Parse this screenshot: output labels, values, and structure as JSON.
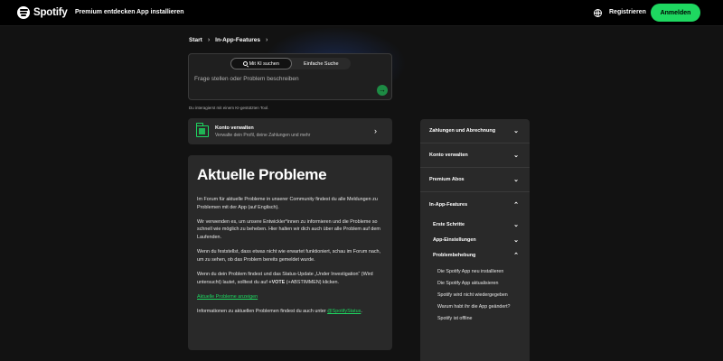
{
  "nav": {
    "logo_text": "Spotify",
    "links": [
      "Premium entdecken",
      "App installieren"
    ],
    "signup": "Registrieren",
    "login": "Anmelden"
  },
  "breadcrumb": [
    "Start",
    "In-App-Features"
  ],
  "search": {
    "tab_ai": "Mit KI suchen",
    "tab_simple": "Einfache Suche",
    "placeholder": "Frage stellen oder Problem beschreiben",
    "send_icon": "arrow-right",
    "ai_note": "Du interagierst mit einem KI-gestützten Tool."
  },
  "account_card": {
    "title": "Konto verwalten",
    "subtitle": "Verwalte dein Profil, deine Zahlungen und mehr"
  },
  "article": {
    "title": "Aktuelle Probleme",
    "p1": "Im Forum für aktuelle Probleme in unserer Community findest du alle Meldungen zu Problemen mit der App (auf Englisch).",
    "p2": "Wir verwenden es, um unsere Entwickler*innen zu informieren und die Probleme so schnell wie möglich zu beheben. Hier halten wir dich auch über alle Problem auf dem Laufenden.",
    "p3": "Wenn du feststellst, dass etwas nicht wie erwartet funktioniert, schau im Forum nach, um zu sehen, ob das Problem bereits gemeldet wurde.",
    "p4_a": "Wenn du dein Problem findest und das Status-Update „Under Investigation“ (Wird untersucht) lautet, solltest du auf ",
    "p4_b": "+VOTE",
    "p4_c": " (+ABSTIMMEN) klicken.",
    "link": "Aktuelle Probleme anzeigen",
    "p5_a": "Informationen zu aktuellen Problemen findest du auch unter ",
    "p5_link": "@SpotifyStatus",
    "p5_b": "."
  },
  "sidebar": {
    "items": [
      "Zahlungen und Abrechnung",
      "Konto verwalten",
      "Premium Abos",
      "In-App-Features"
    ],
    "sub": [
      "Erste Schritte",
      "App-Einstellungen",
      "Problembehebung"
    ],
    "leaves": [
      "Die Spotify App neu installieren",
      "Die Spotify App aktualisieren",
      "Spotify wird nicht wiedergegeben",
      "Warum habt ihr die App geändert?",
      "Spotify ist offline"
    ]
  },
  "colors": {
    "accent": "#1ed760",
    "background": "#121212",
    "card": "#292929"
  }
}
